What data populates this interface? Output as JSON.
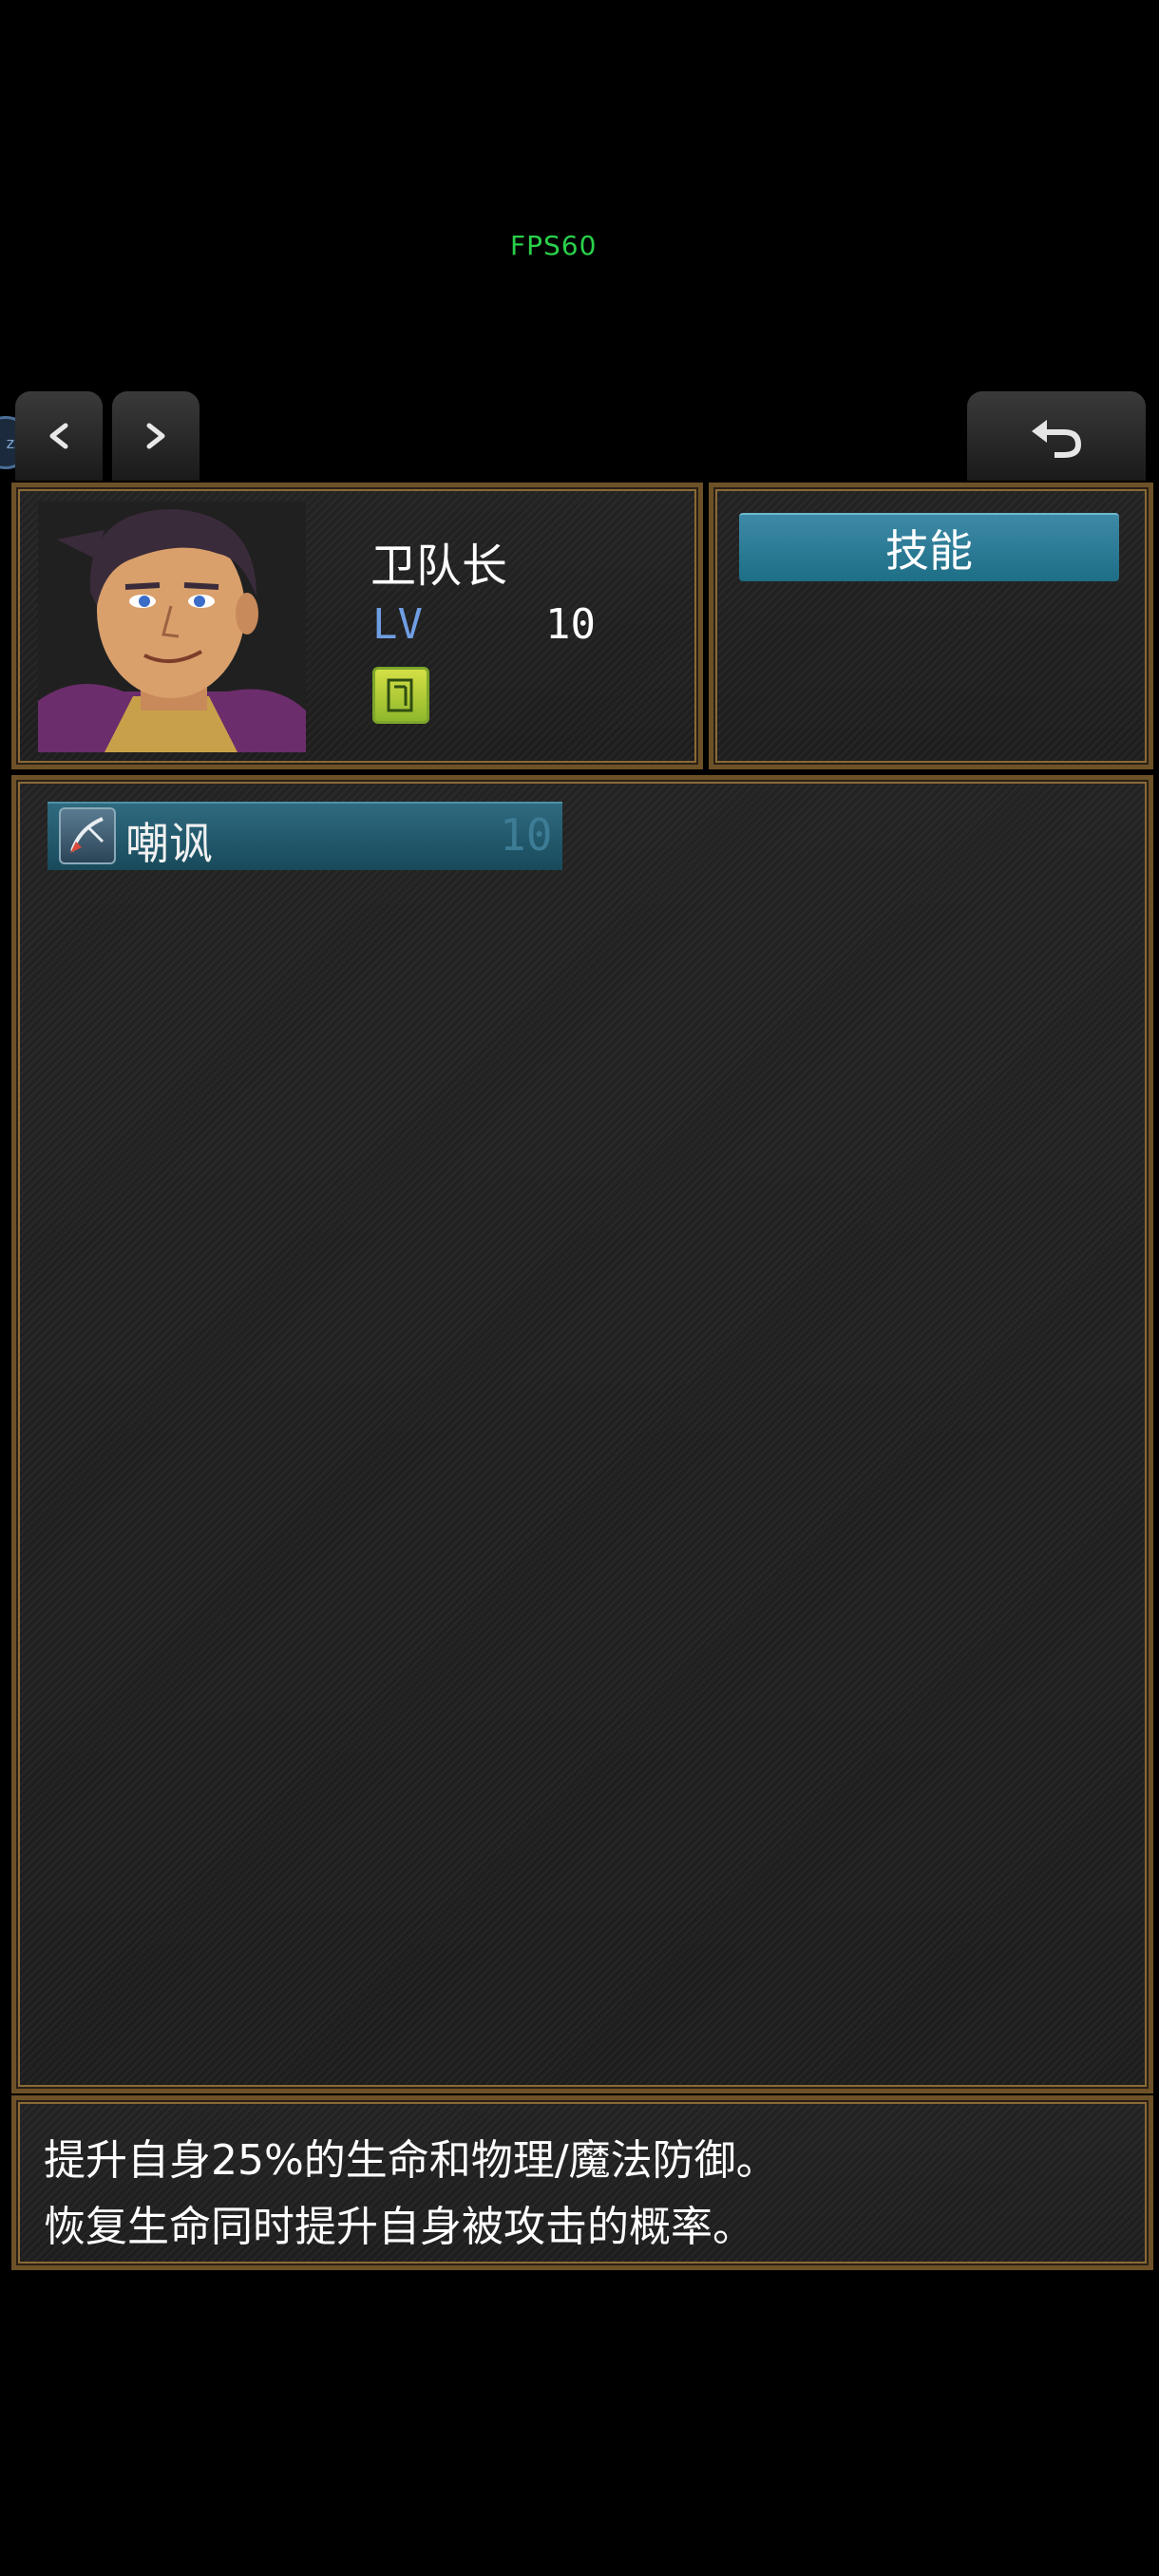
{
  "overlay": {
    "fps_text": "FPS60"
  },
  "nav": {
    "prev_label": "<",
    "next_label": ">",
    "back_icon": "return-arrow-icon",
    "orb_text": "zz"
  },
  "character": {
    "name": "卫队长",
    "level_label": "LV",
    "level_value": "10",
    "book_icon": "skill-book-icon"
  },
  "tabs": {
    "skill_tab_label": "技能"
  },
  "skills": [
    {
      "name": "嘲讽",
      "level": "10",
      "icon": "taunt-skill-icon"
    }
  ],
  "description": {
    "line1": "提升自身25%的生命和物理/魔法防御。",
    "line2": "恢复生命同时提升自身被攻击的概率。"
  },
  "colors": {
    "panel_border": "#6d5127",
    "tab_bg": "#1e6e86",
    "level_label": "#6f9ee3",
    "fps": "#29d14a"
  }
}
